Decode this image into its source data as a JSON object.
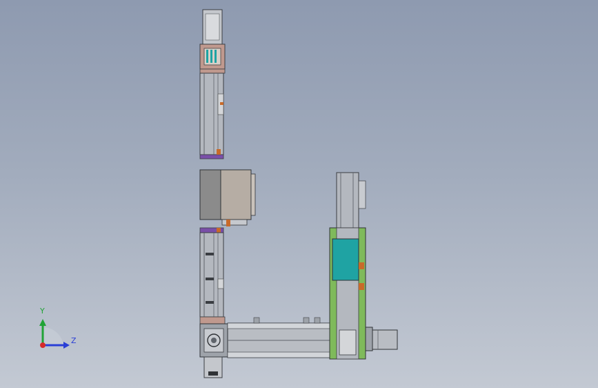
{
  "colors": {
    "background_top": "#8e9ab0",
    "background_bottom": "#c3c9d3",
    "rail": "#b4b8bf",
    "rail_dark": "#5f646b",
    "copper_plate": "#c0998e",
    "gray_block": "#8b8b8b",
    "tan_block": "#b6ada4",
    "purple_cap": "#7a4fa8",
    "green_plate": "#7fba5b",
    "teal_plate": "#1fa3a3",
    "orange_bolt": "#c86a2a",
    "axis_y": "#21a336",
    "axis_z": "#2a3fd6",
    "axis_x": "#d62a2a"
  },
  "view_triad": {
    "y_label": "Y",
    "z_label": "Z",
    "y_icon": "axis-y-arrow",
    "z_icon": "axis-z-arrow",
    "x_icon": "axis-x-dot"
  }
}
